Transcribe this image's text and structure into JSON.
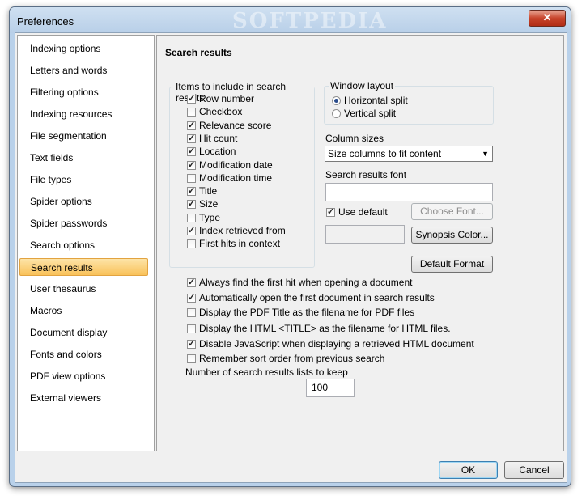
{
  "window": {
    "title": "Preferences",
    "watermark": "SOFTPEDIA",
    "close_glyph": "✕"
  },
  "sidebar": {
    "items": [
      {
        "label": "Indexing options"
      },
      {
        "label": "Letters and words"
      },
      {
        "label": "Filtering options"
      },
      {
        "label": "Indexing resources"
      },
      {
        "label": "File segmentation"
      },
      {
        "label": "Text fields"
      },
      {
        "label": "File types"
      },
      {
        "label": "Spider options"
      },
      {
        "label": "Spider passwords"
      },
      {
        "label": "Search options"
      },
      {
        "label": "Search results",
        "selected": true
      },
      {
        "label": "User thesaurus"
      },
      {
        "label": "Macros"
      },
      {
        "label": "Document display"
      },
      {
        "label": "Fonts and colors"
      },
      {
        "label": "PDF view options"
      },
      {
        "label": "External viewers"
      }
    ]
  },
  "page": {
    "title": "Search results",
    "items_group": {
      "label": "Items to include in search results",
      "items": [
        {
          "label": "Row number",
          "checked": true
        },
        {
          "label": "Checkbox",
          "checked": false
        },
        {
          "label": "Relevance score",
          "checked": true
        },
        {
          "label": "Hit count",
          "checked": true
        },
        {
          "label": "Location",
          "checked": true
        },
        {
          "label": "Modification date",
          "checked": true
        },
        {
          "label": "Modification time",
          "checked": false
        },
        {
          "label": "Title",
          "checked": true
        },
        {
          "label": "Size",
          "checked": true
        },
        {
          "label": "Type",
          "checked": false
        },
        {
          "label": "Index retrieved from",
          "checked": true
        },
        {
          "label": "First hits in context",
          "checked": false
        }
      ]
    },
    "window_layout": {
      "label": "Window layout",
      "options": [
        {
          "label": "Horizontal split",
          "selected": true
        },
        {
          "label": "Vertical split",
          "selected": false
        }
      ]
    },
    "column_sizes": {
      "label": "Column sizes",
      "value": "Size columns to fit content"
    },
    "font": {
      "label": "Search results font",
      "value": "",
      "use_default_label": "Use default",
      "use_default_checked": true,
      "choose_font_label": "Choose Font..."
    },
    "synopsis_color_label": "Synopsis Color...",
    "default_format_label": "Default Format",
    "options": [
      {
        "label": "Always find the first hit when opening a document",
        "checked": true
      },
      {
        "label": "Automatically open the first document in search results",
        "checked": true
      },
      {
        "label": "Display the PDF Title as the filename for PDF files",
        "checked": false
      },
      {
        "label": "Display the HTML <TITLE> as the filename for HTML files.",
        "checked": false
      },
      {
        "label": "Disable JavaScript when displaying a retrieved HTML document",
        "checked": true
      },
      {
        "label": "Remember sort order from previous search",
        "checked": false
      }
    ],
    "lists_to_keep": {
      "label": "Number of search results lists to keep",
      "value": "100"
    }
  },
  "footer": {
    "ok_label": "OK",
    "cancel_label": "Cancel"
  }
}
